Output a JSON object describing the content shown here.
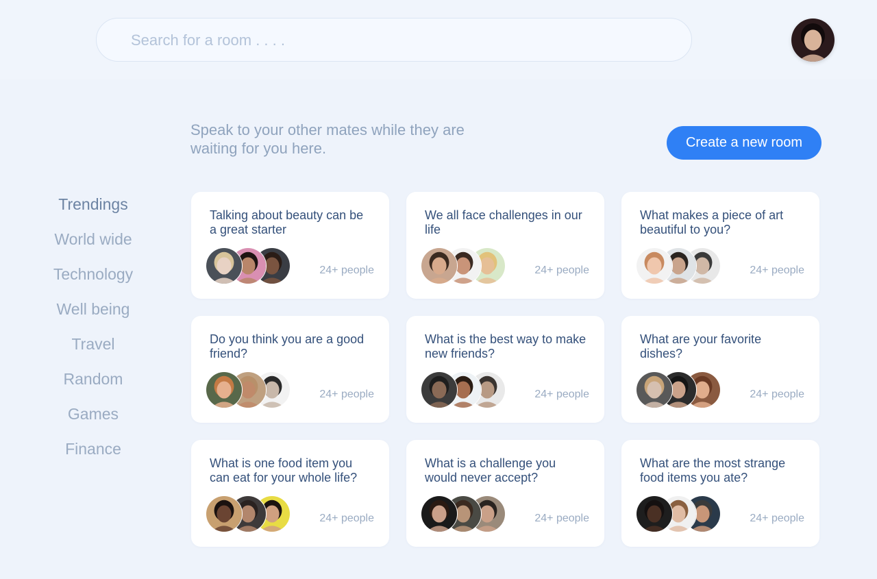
{
  "search": {
    "placeholder": "Search for a room . . . ."
  },
  "profile": {
    "avatar_icon": "user-avatar",
    "colors": {
      "bg": "#2b1a1c",
      "skin": "#d8b39a",
      "hair": "#120b0c"
    }
  },
  "intro": {
    "text": "Speak to your other mates while they are waiting for you here."
  },
  "create_button": {
    "label": "Create a new room",
    "color": "#2f80f5"
  },
  "categories": [
    {
      "label": "Trendings",
      "active": true
    },
    {
      "label": "World wide"
    },
    {
      "label": "Technology"
    },
    {
      "label": "Well being"
    },
    {
      "label": "Travel"
    },
    {
      "label": "Random"
    },
    {
      "label": "Games"
    },
    {
      "label": "Finance"
    }
  ],
  "rooms": [
    {
      "title": "Talking about beauty can be a great starter",
      "count": "24+ people",
      "avatars": [
        {
          "bg": "#4a5058",
          "skin": "#e8d2c4",
          "hair": "#d8c49a"
        },
        {
          "bg": "#d98fb2",
          "skin": "#b9866a",
          "hair": "#1e1412"
        },
        {
          "bg": "#3a3d44",
          "skin": "#7a5440",
          "hair": "#2a1c16"
        }
      ]
    },
    {
      "title": " We all face challenges in our life",
      "count": "24+ people",
      "avatars": [
        {
          "bg": "#c8a690",
          "skin": "#d8aa8c",
          "hair": "#3b2a20"
        },
        {
          "bg": "#f2f2f2",
          "skin": "#c99479",
          "hair": "#3a2a22"
        },
        {
          "bg": "#d8e8c8",
          "skin": "#e6bf96",
          "hair": "#e2c27a"
        }
      ]
    },
    {
      "title": "What makes a piece of art beautiful to you?",
      "count": "24+ people",
      "avatars": [
        {
          "bg": "#f2f2f2",
          "skin": "#f0c7ad",
          "hair": "#c88a60"
        },
        {
          "bg": "#dfe3e6",
          "skin": "#c9a48c",
          "hair": "#2a2420"
        },
        {
          "bg": "#e8e8e8",
          "skin": "#d0b8a6",
          "hair": "#3a3a3a"
        }
      ]
    },
    {
      "title": "Do you think you are a good friend?",
      "count": "24+ people",
      "avatars": [
        {
          "bg": "#58684a",
          "skin": "#e6b08e",
          "hair": "#c47a44"
        },
        {
          "bg": "#bfa080",
          "skin": "#c08a6a",
          "hair": "#b8906a"
        },
        {
          "bg": "#f2f2f2",
          "skin": "#c8b8aa",
          "hair": "#2a2a2a"
        }
      ]
    },
    {
      "title": "What is the best way to make new friends?",
      "count": "24+ people",
      "avatars": [
        {
          "bg": "#3c3c3c",
          "skin": "#8a6a56",
          "hair": "#1e1e1e"
        },
        {
          "bg": "#eef2f5",
          "skin": "#a66e50",
          "hair": "#2a1c14"
        },
        {
          "bg": "#e9e9e9",
          "skin": "#b89a84",
          "hair": "#3a3430"
        }
      ]
    },
    {
      "title": "What are your favorite dishes?",
      "count": "24+ people",
      "avatars": [
        {
          "bg": "#595959",
          "skin": "#d6c0b0",
          "hair": "#c8a478"
        },
        {
          "bg": "#2c2c2c",
          "skin": "#caa28a",
          "hair": "#151515"
        },
        {
          "bg": "#8a5a40",
          "skin": "#e0ad8c",
          "hair": "#6a3a24"
        }
      ]
    },
    {
      "title": "What is one food item you can eat for your whole life?",
      "count": "24+ people",
      "avatars": [
        {
          "bg": "#c8a070",
          "skin": "#6a4432",
          "hair": "#1a1210"
        },
        {
          "bg": "#3e3a3a",
          "skin": "#b2866c",
          "hair": "#2a2220"
        },
        {
          "bg": "#e8dc44",
          "skin": "#d0a080",
          "hair": "#1c1410"
        }
      ]
    },
    {
      "title": "What is a challenge you would never accept?",
      "count": "24+ people",
      "avatars": [
        {
          "bg": "#1a1a1a",
          "skin": "#caa08a",
          "hair": "#2a1a12"
        },
        {
          "bg": "#4a4a44",
          "skin": "#b89478",
          "hair": "#3a2a20"
        },
        {
          "bg": "#9a8a7a",
          "skin": "#caa088",
          "hair": "#2a2420"
        }
      ]
    },
    {
      "title": "What are the most strange food items you ate?",
      "count": "24+ people",
      "avatars": [
        {
          "bg": "#1e1e1e",
          "skin": "#4a3024",
          "hair": "#141010"
        },
        {
          "bg": "#f0f0f0",
          "skin": "#e0bca4",
          "hair": "#8a6040"
        },
        {
          "bg": "#2a3a4a",
          "skin": "#c89678",
          "hair": "#3a3a3a"
        }
      ]
    }
  ]
}
